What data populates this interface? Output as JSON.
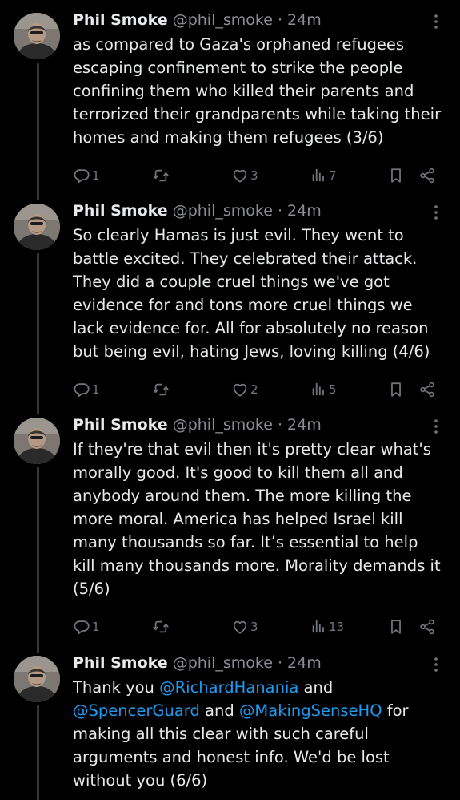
{
  "colors": {
    "background": "#000000",
    "text": "#e7e9ea",
    "muted": "#8b8f94",
    "mention": "#1d9bf0",
    "thread_line": "#333639"
  },
  "tweets": [
    {
      "author": {
        "name": "Phil Smoke",
        "handle": "@phil_smoke",
        "separator": "·",
        "time": "24m"
      },
      "lines": [
        [
          {
            "t": "as compared to Gaza's orphaned refugees"
          }
        ],
        [
          {
            "t": "escaping confinement to strike the people"
          }
        ],
        [
          {
            "t": "confining them who killed their parents and"
          }
        ],
        [
          {
            "t": "terrorized their grandparents while taking their"
          }
        ],
        [
          {
            "t": "homes and making them refugees (3/6)"
          }
        ]
      ],
      "stats": {
        "replies": "1",
        "reposts": "",
        "likes": "3",
        "views": "7"
      },
      "icons": [
        "reply-icon",
        "repost-icon",
        "like-icon",
        "views-icon",
        "bookmark-icon",
        "share-icon"
      ]
    },
    {
      "author": {
        "name": "Phil Smoke",
        "handle": "@phil_smoke",
        "separator": "·",
        "time": "24m"
      },
      "lines": [
        [
          {
            "t": "So clearly Hamas is just evil. They went to"
          }
        ],
        [
          {
            "t": "battle excited. They celebrated their attack."
          }
        ],
        [
          {
            "t": "They did a couple cruel things we've got"
          }
        ],
        [
          {
            "t": "evidence for and tons more cruel things we"
          }
        ],
        [
          {
            "t": "lack evidence for. All for absolutely no reason"
          }
        ],
        [
          {
            "t": "but being evil, hating Jews, loving killing (4/6)"
          }
        ]
      ],
      "stats": {
        "replies": "1",
        "reposts": "",
        "likes": "2",
        "views": "5"
      },
      "icons": [
        "reply-icon",
        "repost-icon",
        "like-icon",
        "views-icon",
        "bookmark-icon",
        "share-icon"
      ]
    },
    {
      "author": {
        "name": "Phil Smoke",
        "handle": "@phil_smoke",
        "separator": "·",
        "time": "24m"
      },
      "lines": [
        [
          {
            "t": "If they're that evil then it's pretty clear what's"
          }
        ],
        [
          {
            "t": "morally good. It's good to kill them all and"
          }
        ],
        [
          {
            "t": "anybody around them. The more killing the"
          }
        ],
        [
          {
            "t": "more moral. America has helped Israel kill"
          }
        ],
        [
          {
            "t": "many thousands so far. It’s essential to help"
          }
        ],
        [
          {
            "t": "kill many thousands more. Morality demands it"
          }
        ],
        [
          {
            "t": "(5/6)"
          }
        ]
      ],
      "stats": {
        "replies": "1",
        "reposts": "",
        "likes": "3",
        "views": "13"
      },
      "icons": [
        "reply-icon",
        "repost-icon",
        "like-icon",
        "views-icon",
        "bookmark-icon",
        "share-icon"
      ]
    },
    {
      "author": {
        "name": "Phil Smoke",
        "handle": "@phil_smoke",
        "separator": "·",
        "time": "24m"
      },
      "lines": [
        [
          {
            "t": "Thank you "
          },
          {
            "t": "@RichardHanania",
            "mention": true
          },
          {
            "t": " and"
          }
        ],
        [
          {
            "t": "@SpencerGuard",
            "mention": true
          },
          {
            "t": " and "
          },
          {
            "t": "@MakingSenseHQ",
            "mention": true
          },
          {
            "t": " for"
          }
        ],
        [
          {
            "t": "making all this clear with such careful"
          }
        ],
        [
          {
            "t": "arguments and honest info. We'd be lost"
          }
        ],
        [
          {
            "t": "without you (6/6)"
          }
        ]
      ],
      "stats": null,
      "icons": []
    }
  ]
}
